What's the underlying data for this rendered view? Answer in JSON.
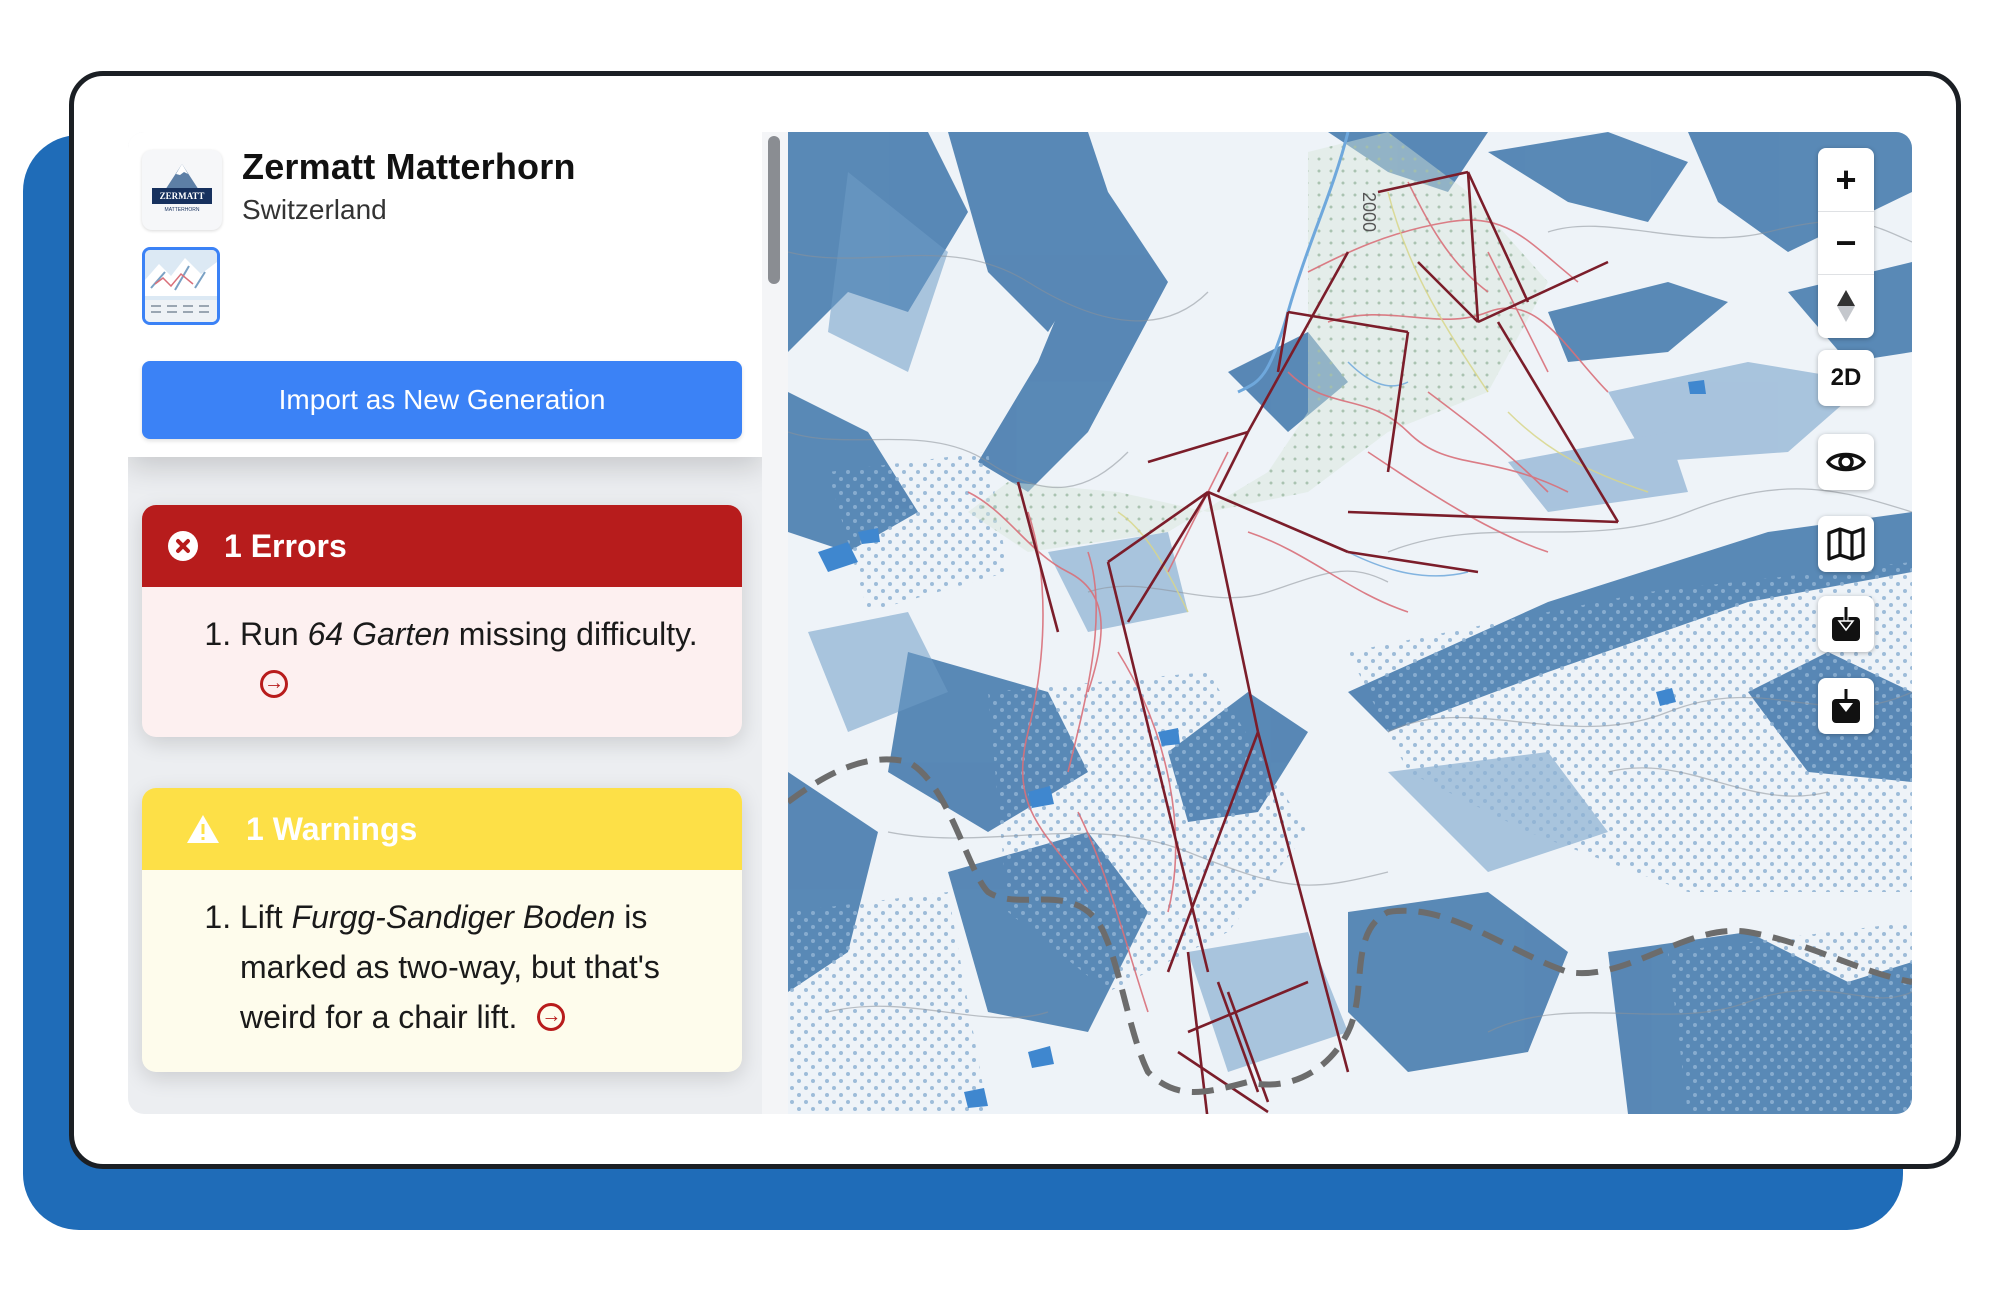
{
  "resort": {
    "name": "Zermatt Matterhorn",
    "country": "Switzerland",
    "logo_text": "ZERMATT",
    "logo_subtext": "MATTERHORN"
  },
  "actions": {
    "import_label": "Import as New Generation"
  },
  "errors": {
    "title": "1 Errors",
    "items": [
      {
        "prefix": "Run ",
        "name": "64 Garten",
        "suffix": " missing difficulty."
      }
    ]
  },
  "warnings": {
    "title": "1 Warnings",
    "items": [
      {
        "prefix": "Lift ",
        "name": "Furgg-Sandiger Boden",
        "suffix": " is marked as two-way, but that's weird for a chair lift."
      }
    ]
  },
  "map": {
    "contour_label": "2000",
    "controls": {
      "zoom_in": "+",
      "zoom_out": "−",
      "view_mode": "2D"
    }
  },
  "colors": {
    "primary": "#3b82f6",
    "error": "#b71c1c",
    "warning": "#fde047",
    "backdrop": "#1f6cb8",
    "lift": "#7b1d2a",
    "run": "#d9707a"
  }
}
